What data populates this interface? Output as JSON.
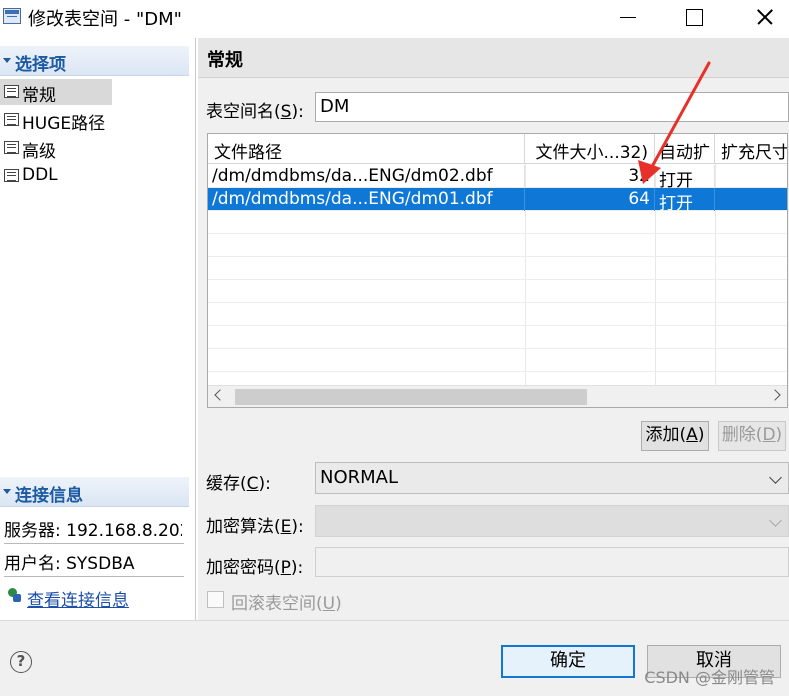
{
  "window": {
    "title": "修改表空间 - \"DM\"",
    "app_icon": "table-window-icon"
  },
  "sidebar": {
    "options_header": "选择项",
    "items": [
      {
        "label": "常规",
        "icon": "doc-icon",
        "selected": true
      },
      {
        "label": "HUGE路径",
        "icon": "doc-icon"
      },
      {
        "label": "高级",
        "icon": "doc-icon"
      },
      {
        "label": "DDL",
        "icon": "doc-icon"
      }
    ],
    "conn_header": "连接信息",
    "server": "服务器: 192.168.8.202",
    "user": "用户名: SYSDBA",
    "view_conn_link": "查看连接信息"
  },
  "general": {
    "header": "常规",
    "name_label_prefix": "表空间名(",
    "name_label_key": "S",
    "name_label_suffix": "):",
    "name_value": "DM",
    "table": {
      "columns": [
        "文件路径",
        "文件大小...32)",
        "自动扩",
        "扩充尺寸"
      ],
      "rows": [
        {
          "path": "/dm/dmdbms/da...ENG/dm02.dbf",
          "size": "32",
          "auto": "打开",
          "ext": ""
        },
        {
          "path": "/dm/dmdbms/da...ENG/dm01.dbf",
          "size": "64",
          "auto": "打开",
          "ext": "",
          "selected": true
        }
      ]
    },
    "add_prefix": "添加(",
    "add_key": "A",
    "add_suffix": ")",
    "delete_prefix": "删除(",
    "delete_key": "D",
    "delete_suffix": ")",
    "cache_prefix": "缓存(",
    "cache_key": "C",
    "cache_suffix": "):",
    "cache_value": "NORMAL",
    "encrypt_algo_prefix": "加密算法(",
    "encrypt_algo_key": "E",
    "encrypt_algo_suffix": "):",
    "encrypt_algo_value": "",
    "encrypt_pwd_prefix": "加密密码(",
    "encrypt_pwd_key": "P",
    "encrypt_pwd_suffix": "):",
    "encrypt_pwd_value": "",
    "rollback_prefix": "回滚表空间(",
    "rollback_key": "U",
    "rollback_suffix": ")"
  },
  "footer": {
    "ok_label": "确定",
    "cancel_label": "取消",
    "watermark": "CSDN @金刚管管"
  },
  "colors": {
    "accent": "#0f78d7",
    "section_header_text": "#1c5aa3",
    "annotation_arrow": "#e8302a"
  }
}
